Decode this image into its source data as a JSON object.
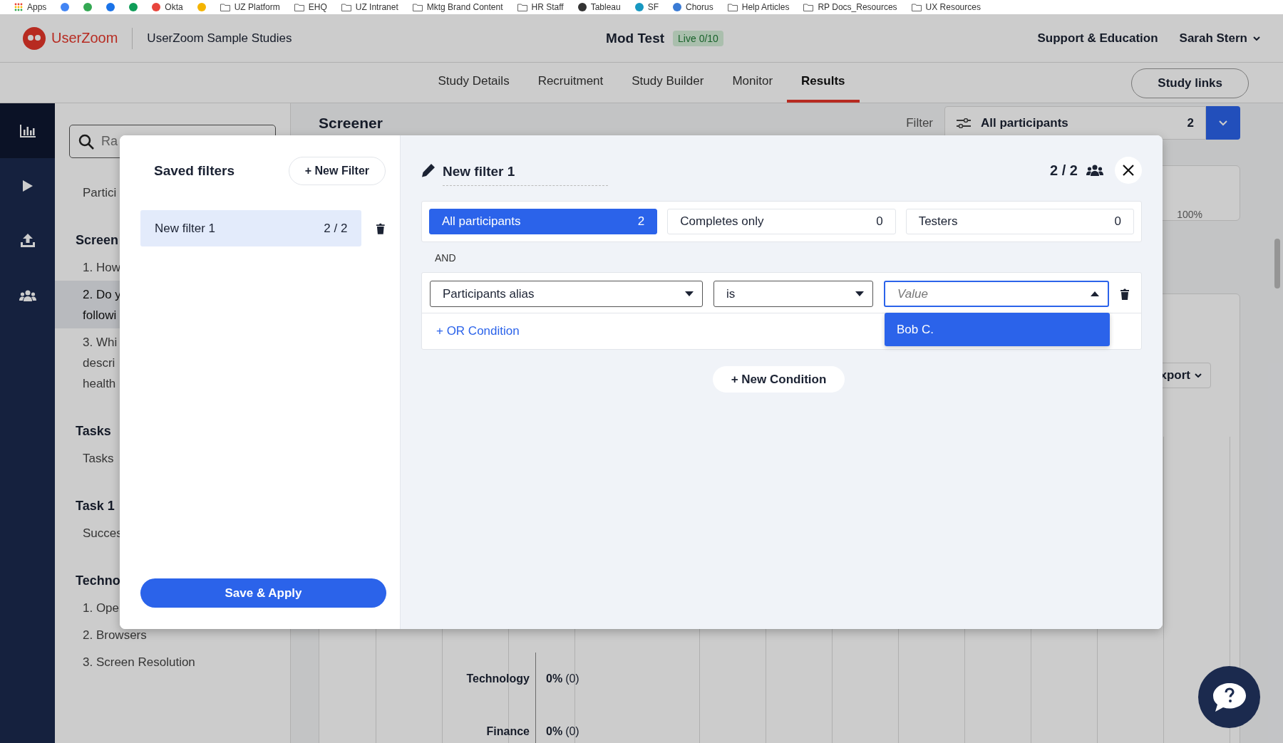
{
  "bookmarks": [
    {
      "kind": "apps",
      "label": "Apps"
    },
    {
      "kind": "site",
      "color": "#4285f4"
    },
    {
      "kind": "site",
      "color": "#34a853"
    },
    {
      "kind": "site",
      "color": "#1a73e8"
    },
    {
      "kind": "site",
      "color": "#0f9d58"
    },
    {
      "kind": "site",
      "color": "#e8453c",
      "label": "Okta"
    },
    {
      "kind": "site",
      "color": "#f4b400"
    },
    {
      "kind": "folder",
      "label": "UZ Platform"
    },
    {
      "kind": "folder",
      "label": "EHQ"
    },
    {
      "kind": "folder",
      "label": "UZ Intranet"
    },
    {
      "kind": "folder",
      "label": "Mktg Brand Content"
    },
    {
      "kind": "folder",
      "label": "HR Staff"
    },
    {
      "kind": "site",
      "color": "#333333",
      "label": "Tableau"
    },
    {
      "kind": "site",
      "color": "#1798c1",
      "label": "SF"
    },
    {
      "kind": "site",
      "color": "#3a7bd5",
      "label": "Chorus"
    },
    {
      "kind": "folder",
      "label": "Help Articles"
    },
    {
      "kind": "folder",
      "label": "RP Docs_Resources"
    },
    {
      "kind": "folder",
      "label": "UX Resources"
    }
  ],
  "header": {
    "logo": "UserZoom",
    "workspace": "UserZoom Sample Studies",
    "study": "Mod Test",
    "status_badge": "Live 0/10",
    "support_link": "Support & Education",
    "user": "Sarah Stern"
  },
  "nav": {
    "tabs": [
      {
        "label": "Study Details",
        "selected": false
      },
      {
        "label": "Recruitment",
        "selected": false
      },
      {
        "label": "Study Builder",
        "selected": false
      },
      {
        "label": "Monitor",
        "selected": false
      },
      {
        "label": "Results",
        "selected": true
      }
    ],
    "study_links_button": "Study links"
  },
  "rail": [
    {
      "kind": "chart",
      "selected": true
    },
    {
      "kind": "play",
      "selected": false
    },
    {
      "kind": "upload",
      "selected": false
    },
    {
      "kind": "people",
      "selected": false
    }
  ],
  "sidebar": {
    "search": {
      "placeholder": "Ra"
    },
    "entries": [
      {
        "kind": "item",
        "lines": [
          "Partici"
        ],
        "selected": false
      },
      {
        "kind": "heading",
        "text": "Screen"
      },
      {
        "kind": "item",
        "lines": [
          "1. How"
        ],
        "selected": false
      },
      {
        "kind": "item",
        "lines": [
          "2. Do y",
          "followi"
        ],
        "selected": true
      },
      {
        "kind": "item",
        "lines": [
          "3. Whi",
          "descri",
          "health"
        ],
        "selected": false
      },
      {
        "kind": "heading",
        "text": "Tasks"
      },
      {
        "kind": "item",
        "lines": [
          "Tasks"
        ],
        "selected": false
      },
      {
        "kind": "heading",
        "text": "Task 1"
      },
      {
        "kind": "item",
        "lines": [
          "Succes"
        ],
        "selected": false
      },
      {
        "kind": "heading",
        "text": "Techno"
      },
      {
        "kind": "item",
        "lines": [
          "1. Ope"
        ],
        "selected": false
      },
      {
        "kind": "item",
        "lines": [
          "2. Browsers"
        ],
        "selected": false
      },
      {
        "kind": "item",
        "lines": [
          "3. Screen Resolution"
        ],
        "selected": false
      }
    ]
  },
  "main": {
    "title": "Screener",
    "filter_label": "Filter",
    "filter": {
      "value": "All participants",
      "count": "2"
    },
    "axis_label": "100%",
    "export_button": "xport",
    "chart_rows": [
      {
        "label": "Technology",
        "value": "0%",
        "count": "(0)"
      },
      {
        "label": "Finance",
        "value": "0%",
        "count": "(0)"
      }
    ]
  },
  "modal": {
    "saved_filters": {
      "title": "Saved filters",
      "new_button": "+ New Filter",
      "items": [
        {
          "name": "New filter 1",
          "count": "2 / 2",
          "selected": true
        }
      ],
      "save_button": "Save & Apply"
    },
    "editor": {
      "name": "New filter 1",
      "count": "2 / 2",
      "segments": [
        {
          "label": "All participants",
          "count": "2",
          "selected": true
        },
        {
          "label": "Completes only",
          "count": "0",
          "selected": false
        },
        {
          "label": "Testers",
          "count": "0",
          "selected": false
        }
      ],
      "operator": "AND",
      "conditions": [
        {
          "field": "Participants alias",
          "comparator": "is",
          "value_placeholder": "Value",
          "open": true,
          "options": [
            {
              "label": "Bob C.",
              "selected": true
            }
          ]
        }
      ],
      "or_link": "+ OR Condition",
      "new_condition_button": "+ New Condition"
    }
  }
}
